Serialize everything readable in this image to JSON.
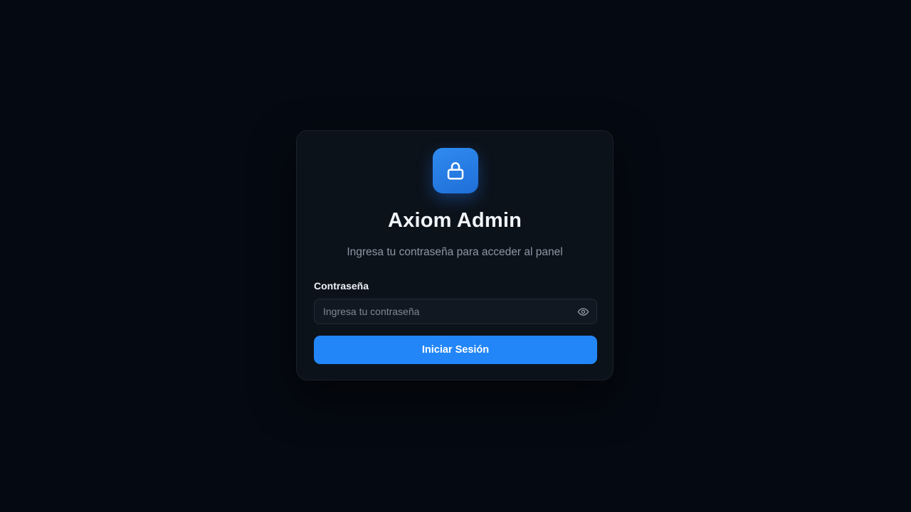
{
  "app": {
    "title": "Axiom Admin",
    "subtitle": "Ingresa tu contraseña para acceder al panel",
    "logo_icon": "lock-icon"
  },
  "form": {
    "password_label": "Contraseña",
    "password_placeholder": "Ingresa tu contraseña",
    "password_value": "",
    "toggle_visibility_icon": "eye-icon",
    "submit_label": "Iniciar Sesión"
  },
  "colors": {
    "background": "#050911",
    "card": "#0c121a",
    "accent": "#2286f8",
    "text_primary": "#f1f4f8",
    "text_muted": "#8d96a3"
  }
}
